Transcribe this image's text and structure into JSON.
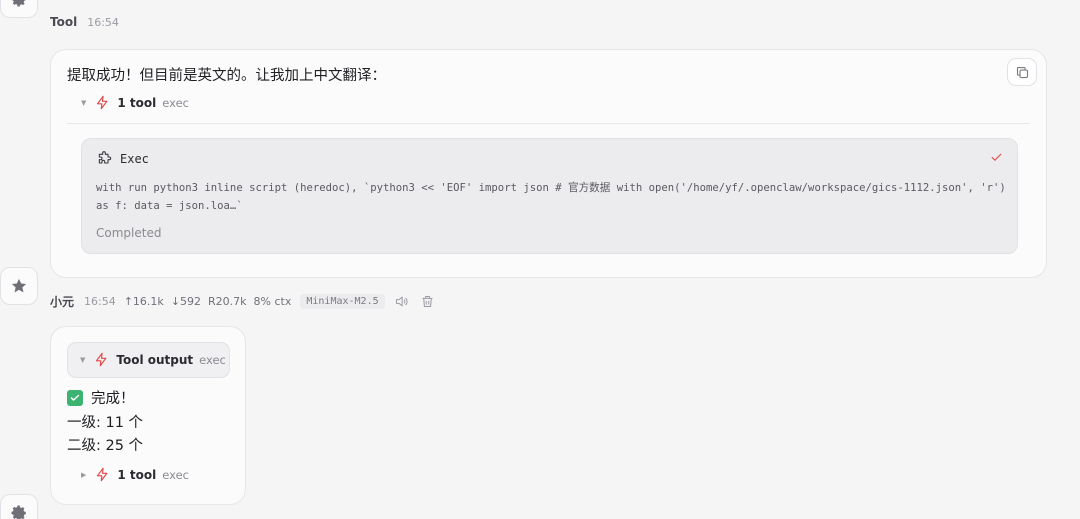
{
  "top_meta": {
    "sender": "Tool",
    "time": "16:54"
  },
  "message1": {
    "text": "提取成功！但目前是英文的。让我加上中文翻译：",
    "tool_summary": {
      "label": "1 tool",
      "sub": "exec"
    },
    "exec": {
      "title": "Exec",
      "command": "with run python3 inline script (heredoc), `python3 << 'EOF' import json # 官方数据 with open('/home/yf/.openclaw/workspace/gics-1112.json', 'r') as f: data = json.loa…`",
      "status": "Completed"
    }
  },
  "meta2": {
    "sender": "小元",
    "time": "16:54",
    "up": "↑16.1k",
    "down": "↓592",
    "r": "R20.7k",
    "ctx": "8% ctx",
    "model": "MiniMax-M2.5"
  },
  "message2": {
    "tool_output": {
      "label": "Tool output",
      "sub": "exec"
    },
    "done": "完成！",
    "line2": "一级: 11 个",
    "line3": "二级: 25 个",
    "tool_summary": {
      "label": "1 tool",
      "sub": "exec"
    }
  },
  "icons": {
    "avatar_top": "gear-icon",
    "avatar_mid": "star-icon",
    "avatar_bot": "gear-icon",
    "copy": "copy-icon",
    "bolt": "bolt-icon",
    "puzzle": "puzzle-icon",
    "check": "check-icon",
    "speaker": "speaker-icon",
    "trash": "trash-icon"
  },
  "colors": {
    "accent": "#e04a4a",
    "success": "#3cb371"
  }
}
